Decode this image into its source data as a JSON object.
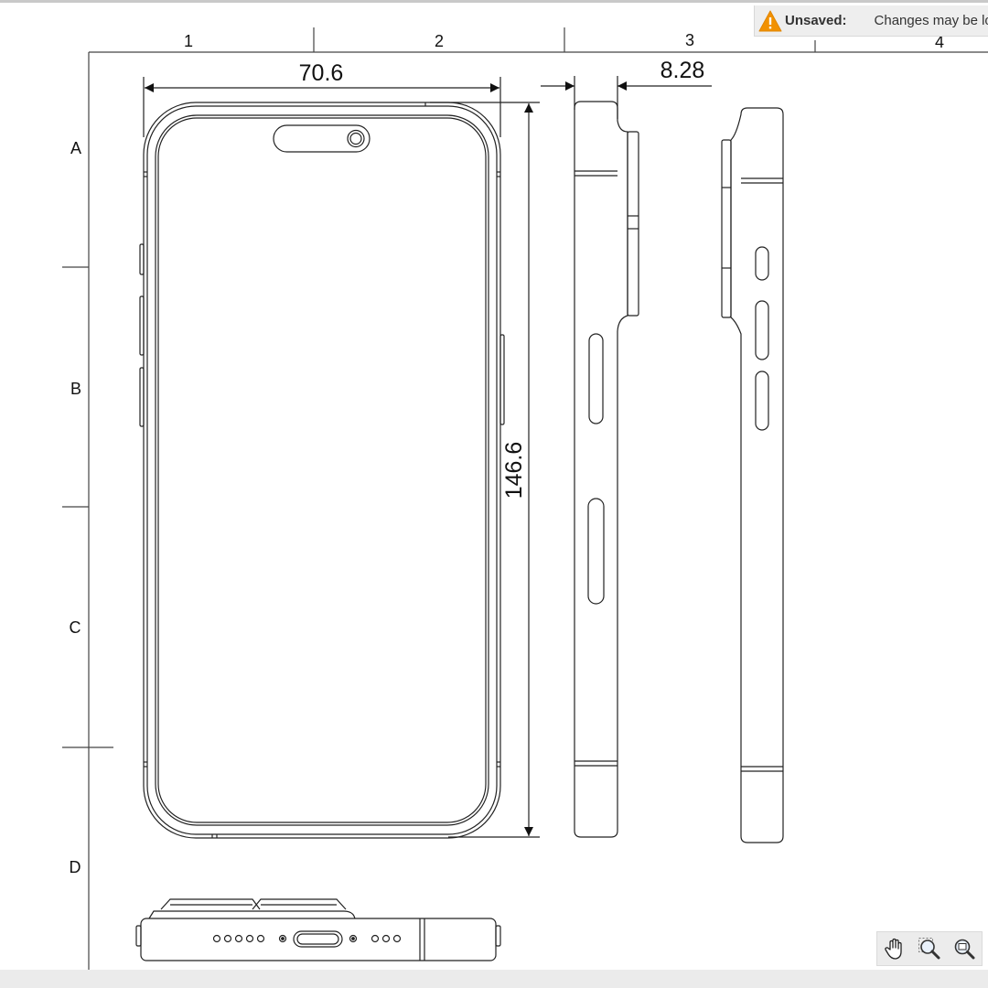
{
  "notice": {
    "title": "Unsaved:",
    "message": "Changes may be lost",
    "icon": "warning-icon",
    "icon_color": "#f29100"
  },
  "drawing": {
    "column_labels": [
      "1",
      "2",
      "3",
      "4"
    ],
    "row_labels": [
      "A",
      "B",
      "C",
      "D"
    ],
    "dimensions": {
      "width": "70.6",
      "height": "146.6",
      "thickness": "8.28"
    }
  },
  "toolbar": {
    "tools": [
      {
        "name": "pan-tool",
        "icon": "hand-icon"
      },
      {
        "name": "zoom-tool",
        "icon": "magnifier-icon"
      },
      {
        "name": "zoom-fit-tool",
        "icon": "magnifier-window-icon"
      }
    ]
  }
}
